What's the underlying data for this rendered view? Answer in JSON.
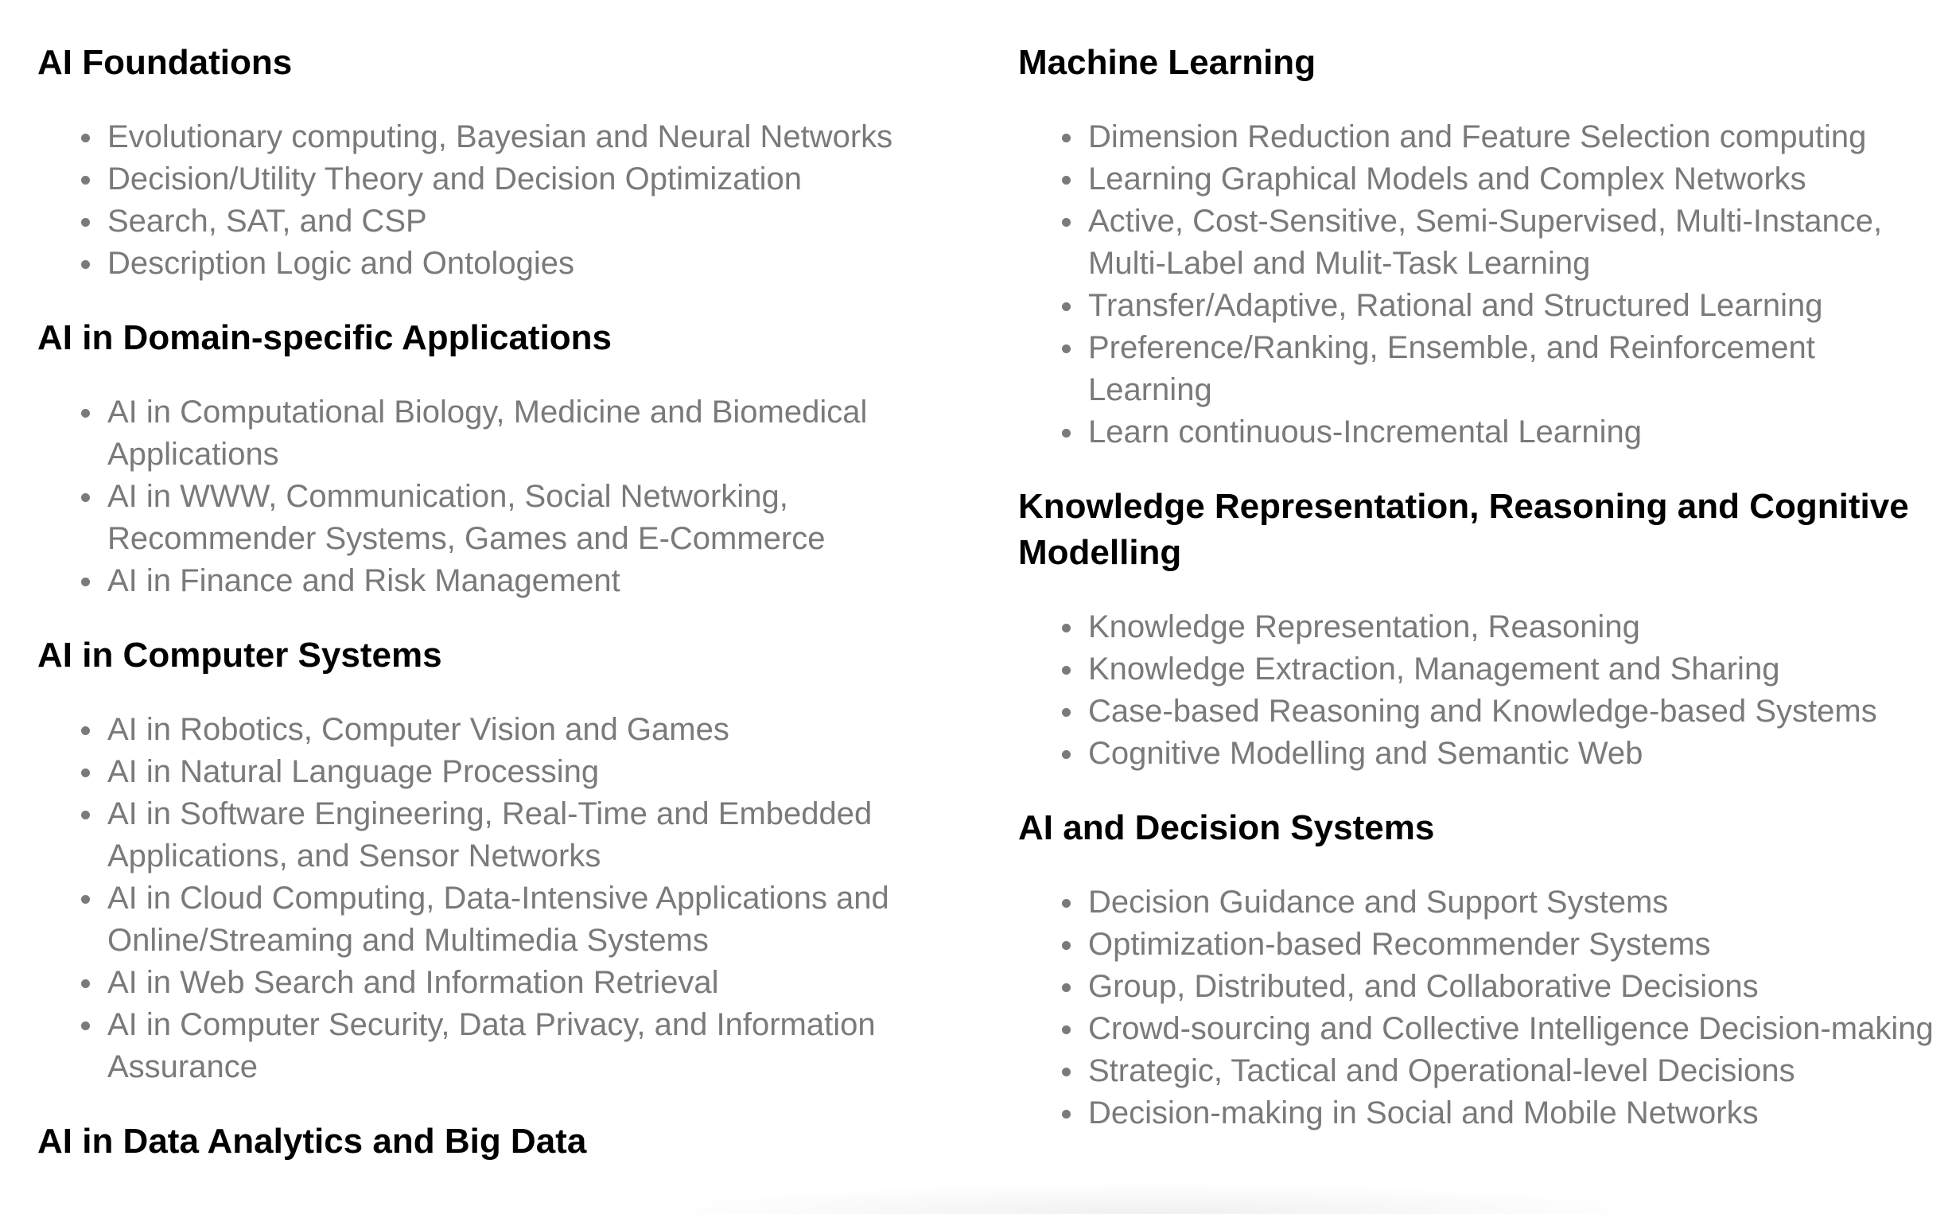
{
  "left_column": {
    "sections": [
      {
        "title": "AI Foundations",
        "items": [
          "Evolutionary computing, Bayesian and Neural Networks",
          "Decision/Utility Theory and Decision Optimization",
          "Search, SAT, and CSP",
          "Description Logic and Ontologies"
        ]
      },
      {
        "title": "AI in Domain-specific Applications",
        "items": [
          "AI in Computational Biology, Medicine and Biomedical Applications",
          "AI in WWW, Communication, Social Networking, Recommender Systems, Games and E-Commerce",
          "AI in Finance and Risk Management"
        ]
      },
      {
        "title": "AI in Computer Systems",
        "items": [
          "AI in Robotics, Computer Vision and Games",
          "AI in Natural Language Processing",
          "AI in Software Engineering, Real-Time and Embedded Applications, and Sensor Networks",
          "AI in Cloud Computing, Data-Intensive Applications and Online/Streaming and Multimedia Systems",
          "AI in Web Search and Information Retrieval",
          "AI in Computer Security, Data Privacy, and Information Assurance"
        ]
      },
      {
        "title": "AI in Data Analytics and Big Data",
        "items": []
      }
    ]
  },
  "right_column": {
    "sections": [
      {
        "title": "Machine Learning",
        "items": [
          "Dimension Reduction and Feature Selection computing",
          "Learning Graphical Models and Complex Networks",
          "Active, Cost-Sensitive, Semi-Supervised, Multi-Instance, Multi-Label and Mulit-Task Learning",
          "Transfer/Adaptive, Rational and Structured Learning",
          "Preference/Ranking, Ensemble, and Reinforcement Learning",
          "Learn continuous-Incremental Learning"
        ]
      },
      {
        "title": "Knowledge Representation, Reasoning and Cognitive Modelling",
        "items": [
          "Knowledge Representation, Reasoning",
          "Knowledge Extraction, Management and Sharing",
          "Case-based Reasoning and Knowledge-based Systems",
          "Cognitive Modelling and Semantic Web"
        ]
      },
      {
        "title": "AI and Decision Systems",
        "items": [
          "Decision Guidance and Support Systems",
          "Optimization-based Recommender Systems",
          "Group, Distributed, and Collaborative Decisions",
          "Crowd-sourcing and Collective Intelligence Decision-making",
          "Strategic, Tactical and Operational-level Decisions",
          "Decision-making in Social and Mobile Networks"
        ]
      }
    ]
  }
}
